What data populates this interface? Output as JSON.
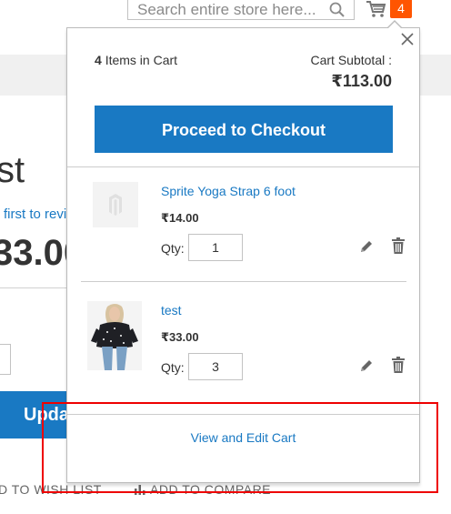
{
  "header": {
    "search_placeholder": "Search entire store here...",
    "cart_count": "4"
  },
  "background_page": {
    "product_title_fragment": "st",
    "review_link_fragment": "first to revi",
    "price_fragment": "33.00",
    "update_button_fragment": "Upda",
    "wishlist_fragment": "D TO WISH LIST",
    "compare_label": "ADD TO COMPARE"
  },
  "minicart": {
    "items_count": "4",
    "items_label": "Items in Cart",
    "subtotal_label": "Cart Subtotal :",
    "subtotal_amount": "₹113.00",
    "checkout_label": "Proceed to Checkout",
    "qty_label": "Qty:",
    "view_edit_label": "View and Edit Cart",
    "items": [
      {
        "name": "Sprite Yoga Strap 6 foot",
        "price": "₹14.00",
        "qty": "1",
        "image": "placeholder-logo"
      },
      {
        "name": "test",
        "price": "₹33.00",
        "qty": "3",
        "image": "photo-person"
      }
    ]
  },
  "colors": {
    "accent_blue": "#1979c3",
    "badge_orange": "#ff5501",
    "highlight_red": "#ee0000"
  }
}
